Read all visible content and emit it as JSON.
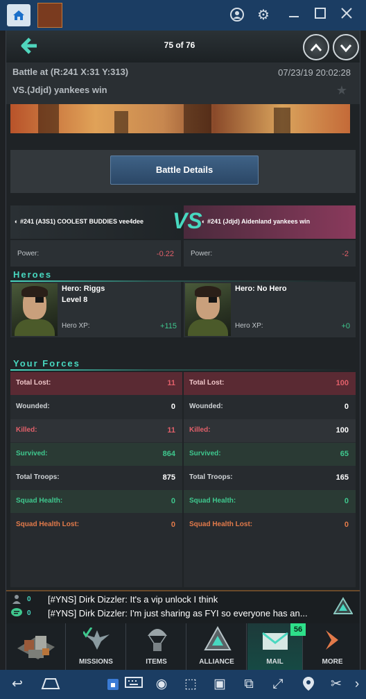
{
  "window": {
    "icons": [
      "home-icon",
      "app-thumbnail-icon",
      "account-icon",
      "settings-icon",
      "minimize-icon",
      "maximize-icon",
      "close-icon"
    ]
  },
  "header": {
    "counter": "75 of 76"
  },
  "battle": {
    "location": "Battle at (R:241 X:31 Y:313)",
    "datetime": "07/23/19 20:02:28",
    "result": "VS.(Jdjd) yankees win",
    "details_button": "Battle Details"
  },
  "versus": {
    "badge": "VS",
    "left_name": "#241 (A3S1) COOLEST BUDDIES vee4dee",
    "right_name": "#241 (Jdjd) Aidenland yankees win",
    "power_label": "Power:",
    "left_power": "-0.22",
    "right_power": "-2"
  },
  "heroes": {
    "title": "Heroes",
    "left": {
      "name": "Hero: Riggs",
      "level": "Level 8",
      "xp_label": "Hero XP:",
      "xp": "+115"
    },
    "right": {
      "name": "Hero: No Hero",
      "xp_label": "Hero XP:",
      "xp": "+0"
    }
  },
  "forces": {
    "title": "Your Forces",
    "left": [
      {
        "label": "Total Lost:",
        "value": "11"
      },
      {
        "label": "Wounded:",
        "value": "0"
      },
      {
        "label": "Killed:",
        "value": "11"
      },
      {
        "label": "Survived:",
        "value": "864"
      },
      {
        "label": "Total Troops:",
        "value": "875"
      },
      {
        "label": "Squad Health:",
        "value": "0"
      },
      {
        "label": "Squad Health Lost:",
        "value": "0"
      }
    ],
    "right": [
      {
        "label": "Total Lost:",
        "value": "100"
      },
      {
        "label": "Wounded:",
        "value": "0"
      },
      {
        "label": "Killed:",
        "value": "100"
      },
      {
        "label": "Survived:",
        "value": "65"
      },
      {
        "label": "Total Troops:",
        "value": "165"
      },
      {
        "label": "Squad Health:",
        "value": "0"
      },
      {
        "label": "Squad Health Lost:",
        "value": "0"
      }
    ]
  },
  "chat": {
    "friends_count": "0",
    "chat_count": "0",
    "line1": "[#YNS] Dirk Dizzler: It's a vip unlock I think",
    "line2": "[#YNS] Dirk Dizzler: I'm just sharing as FYI so everyone has an..."
  },
  "nav": {
    "missions": "MISSIONS",
    "items": "ITEMS",
    "alliance": "ALLIANCE",
    "mail": "MAIL",
    "mail_badge": "56",
    "more": "MORE"
  },
  "colors": {
    "accent": "#48d8c0",
    "red": "#e2606a",
    "green": "#3fc88e",
    "orange": "#e27a4a",
    "titlebar": "#1b3d63"
  }
}
